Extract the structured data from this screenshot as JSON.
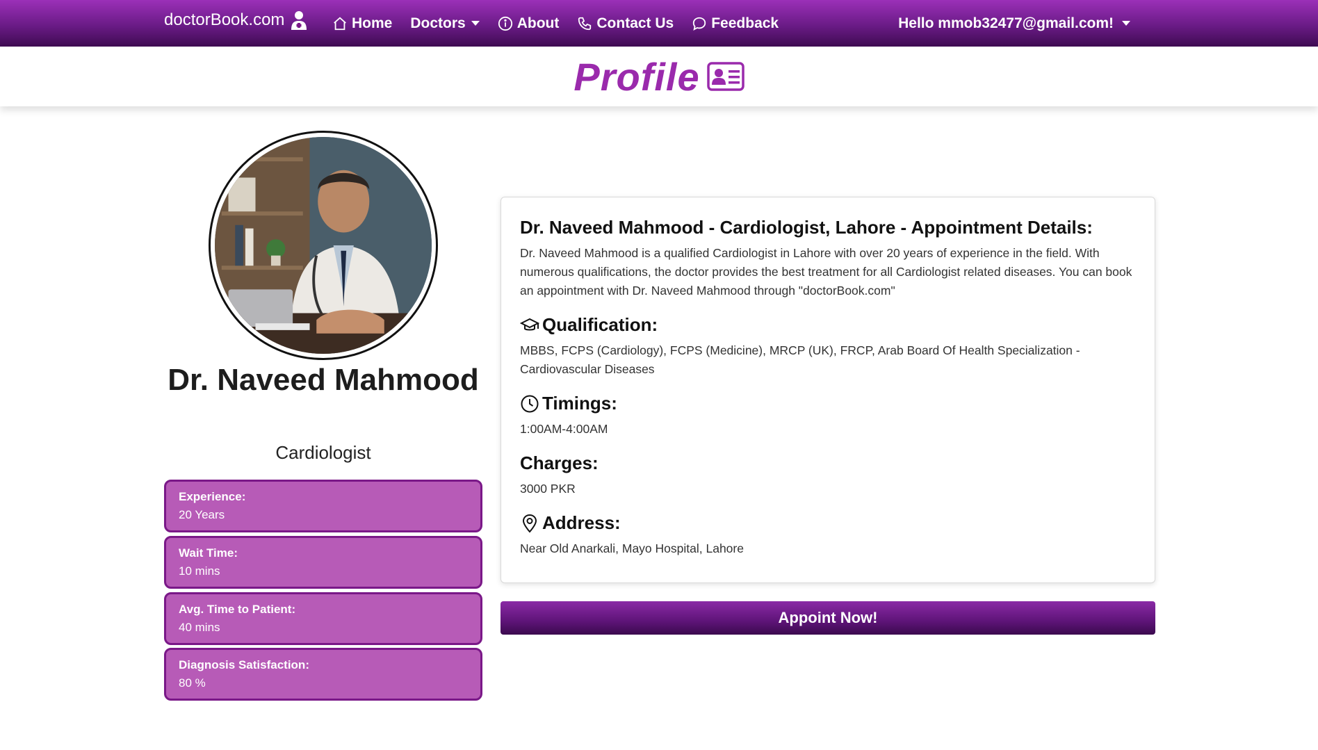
{
  "navbar": {
    "brand": "doctorBook.com",
    "items": [
      {
        "label": "Home",
        "icon": "house-icon"
      },
      {
        "label": "Doctors",
        "icon": null,
        "dropdown": true
      },
      {
        "label": "About",
        "icon": "info-circle-icon"
      },
      {
        "label": "Contact Us",
        "icon": "phone-icon"
      },
      {
        "label": "Feedback",
        "icon": "chat-bubble-icon"
      }
    ],
    "user_greeting": "Hello mmob32477@gmail.com!"
  },
  "page": {
    "title": "Profile",
    "title_icon": "id-card-icon"
  },
  "doctor": {
    "name": "Dr. Naveed Mahmood",
    "specialty": "Cardiologist",
    "photo_icon": "doctor-portrait"
  },
  "stats": [
    {
      "label": "Experience:",
      "value": "20 Years"
    },
    {
      "label": "Wait Time:",
      "value": "10 mins"
    },
    {
      "label": "Avg. Time to Patient:",
      "value": "40 mins"
    },
    {
      "label": "Diagnosis Satisfaction:",
      "value": "80 %"
    }
  ],
  "details": {
    "title": "Dr. Naveed Mahmood - Cardiologist, Lahore - Appointment Details:",
    "description": "Dr. Naveed Mahmood is a qualified Cardiologist in Lahore with over 20 years of experience in the field. With numerous qualifications, the doctor provides the best treatment for all Cardiologist related diseases. You can book an appointment with Dr. Naveed Mahmood through \"doctorBook.com\"",
    "qualification_label": "Qualification:",
    "qualification": "MBBS, FCPS (Cardiology), FCPS (Medicine), MRCP (UK), FRCP, Arab Board Of Health Specialization - Cardiovascular Diseases",
    "timings_label": "Timings:",
    "timings": "1:00AM-4:00AM",
    "charges_label": "Charges:",
    "charges": "3000 PKR",
    "address_label": "Address:",
    "address": "Near Old Anarkali, Mayo Hospital, Lahore"
  },
  "appoint_button": "Appoint Now!",
  "colors": {
    "brand_purple": "#9a2aac",
    "stat_box_fill": "#b75bb7",
    "stat_box_border": "#7a1888"
  }
}
